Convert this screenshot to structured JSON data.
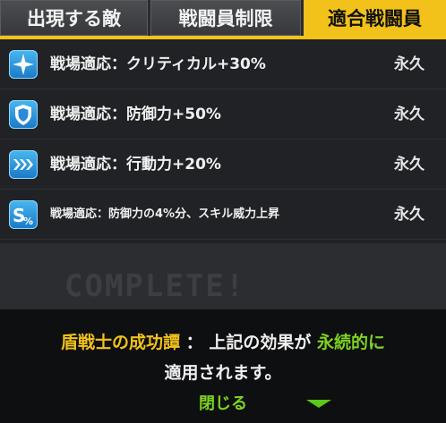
{
  "tabs": [
    {
      "label": "出現する敵"
    },
    {
      "label": "戦闘員制限"
    },
    {
      "label": "適合戦闘員"
    }
  ],
  "effects": [
    {
      "label": "戦場適応：クリティカル+30%",
      "duration": "永久",
      "icon": "crit-icon"
    },
    {
      "label": "戦場適応：防御力+50%",
      "duration": "永久",
      "icon": "shield-icon"
    },
    {
      "label": "戦場適応：行動力+20%",
      "duration": "永久",
      "icon": "speed-icon"
    },
    {
      "label": "戦場適応：防御力の4%分、スキル威力上昇",
      "duration": "永久",
      "icon": "skill-percent-icon"
    }
  ],
  "background_text": "COMPLETE!",
  "footer": {
    "name": "盾戦士の成功譚",
    "sep": "：",
    "text1": "上記の効果が",
    "highlight": "永続的に",
    "text2": "適用されます。",
    "close_label": "閉じる"
  },
  "colors": {
    "accent": "#f2c21a",
    "green": "#7ed321",
    "icon_blue": "#2a8ad8"
  }
}
